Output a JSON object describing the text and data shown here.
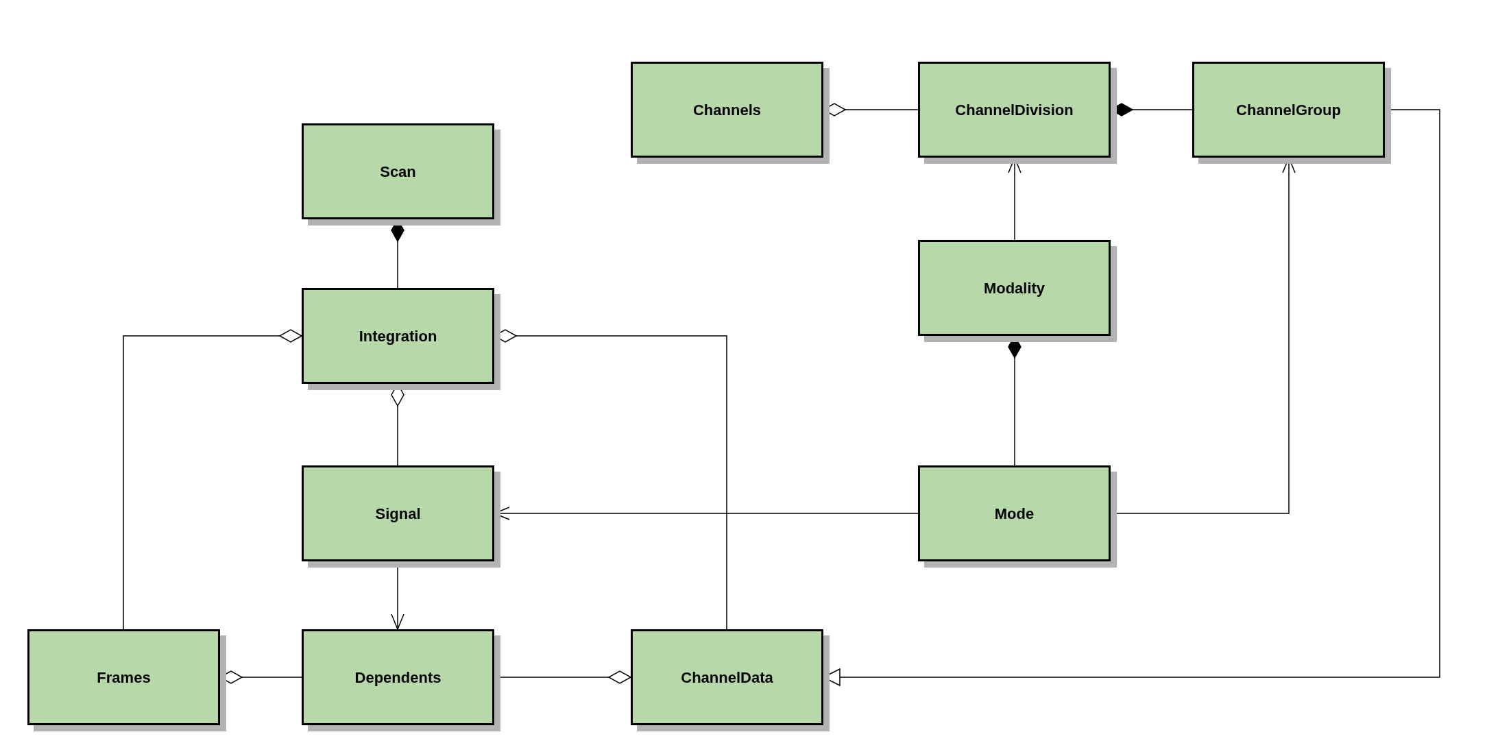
{
  "diagram": {
    "classes": [
      {
        "name": "Channels"
      },
      {
        "name": "ChannelDivision"
      },
      {
        "name": "ChannelGroup"
      },
      {
        "name": "Scan"
      },
      {
        "name": "Modality"
      },
      {
        "name": "Integration"
      },
      {
        "name": "Signal"
      },
      {
        "name": "Mode"
      },
      {
        "name": "Frames"
      },
      {
        "name": "Dependents"
      },
      {
        "name": "ChannelData"
      }
    ]
  }
}
